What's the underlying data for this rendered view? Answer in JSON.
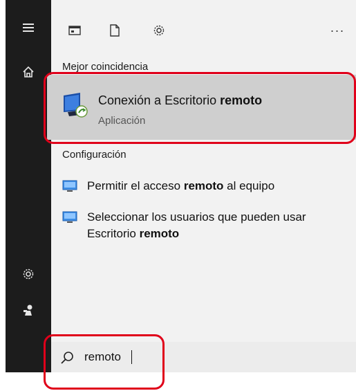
{
  "rail": {
    "items": [
      {
        "icon": "hamburger-menu-icon"
      },
      {
        "icon": "home-icon"
      },
      {
        "icon": "settings-icon"
      },
      {
        "icon": "user-icon"
      }
    ]
  },
  "toolbar": {
    "items": [
      {
        "icon": "apps-icon"
      },
      {
        "icon": "documents-icon"
      },
      {
        "icon": "settings-icon"
      }
    ],
    "more_label": "···"
  },
  "best_match": {
    "heading": "Mejor coincidencia",
    "title_prefix": "Conexión a Escritorio ",
    "title_keyword": "remoto",
    "subtitle": "Aplicación"
  },
  "settings_section": {
    "heading": "Configuración",
    "items": [
      {
        "prefix": "Permitir el acceso ",
        "keyword": "remoto",
        "suffix": " al equipo"
      },
      {
        "prefix": "Seleccionar los usuarios que pueden usar Escritorio ",
        "keyword": "remoto",
        "suffix": ""
      }
    ]
  },
  "search": {
    "value": "remoto"
  },
  "colors": {
    "rail": "#1c1c1c",
    "panel": "#f2f2f2",
    "selected": "#cfcfcf",
    "highlight": "#e0001a"
  }
}
